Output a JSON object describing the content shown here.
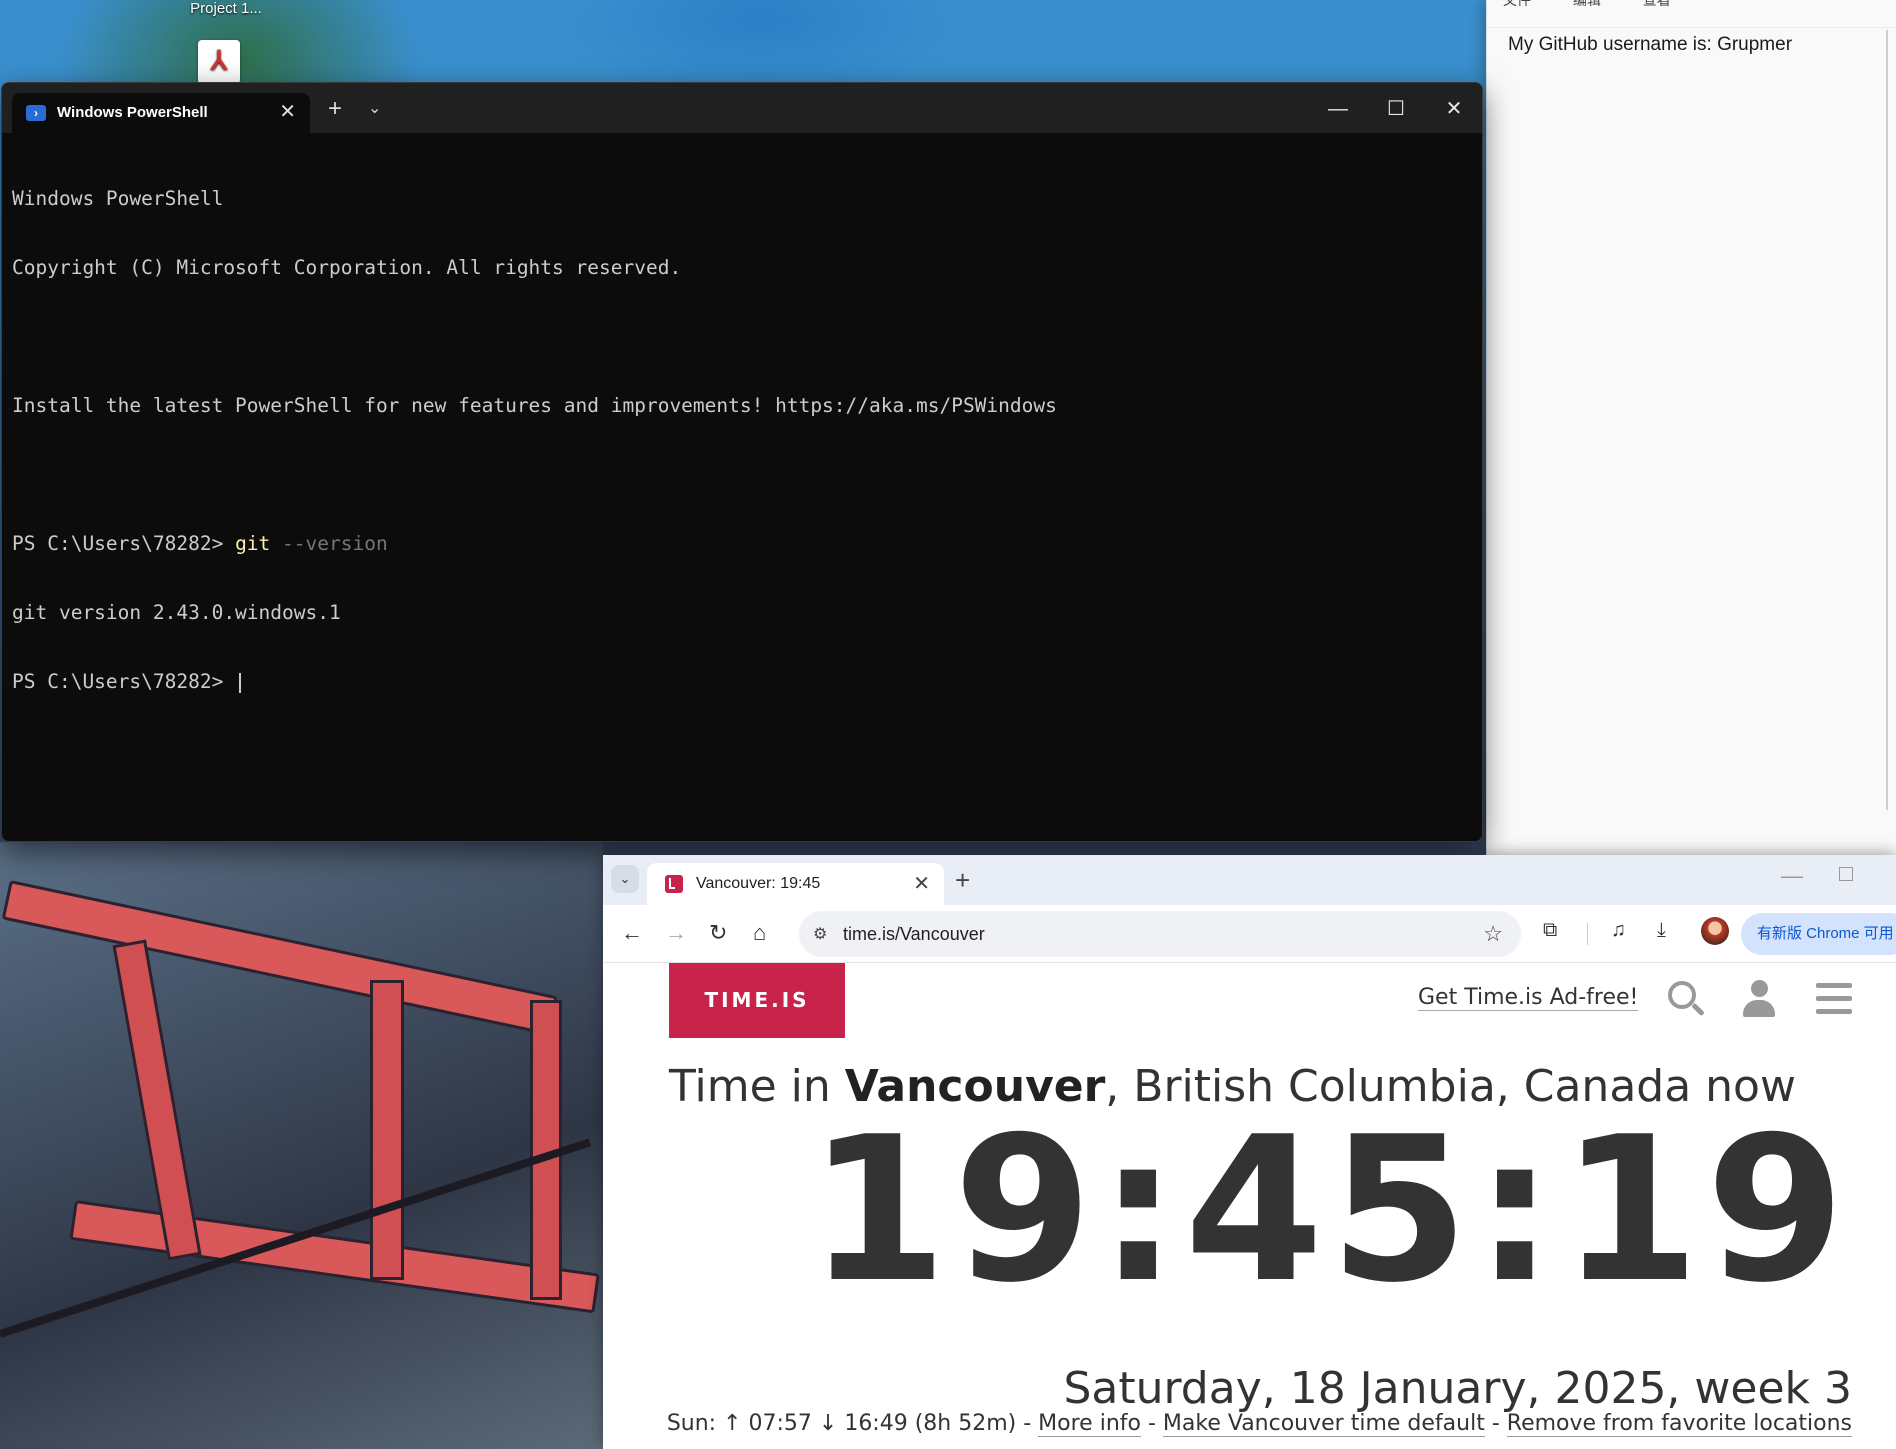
{
  "desktop": {
    "icon_label": "Project 1..."
  },
  "notepad": {
    "menu": [
      "文件",
      "编辑",
      "查看"
    ],
    "content": "My GitHub username is: Grupmer"
  },
  "terminal": {
    "tab_title": "Windows PowerShell",
    "lines": {
      "l1": "Windows PowerShell",
      "l2": "Copyright (C) Microsoft Corporation. All rights reserved.",
      "l3": "Install the latest PowerShell for new features and improvements! https://aka.ms/PSWindows",
      "prompt1": "PS C:\\Users\\78282> ",
      "cmd": "git",
      "cmd_arg": " --version",
      "output": "git version 2.43.0.windows.1",
      "prompt2": "PS C:\\Users\\78282> "
    }
  },
  "chrome": {
    "tab_title": "Vancouver: 19:45",
    "url": "time.is/Vancouver",
    "update_label": "有新版 Chrome 可用"
  },
  "page": {
    "logo": "TIME.IS",
    "adfree": "Get Time.is Ad-free!",
    "headline_pre": "Time in ",
    "headline_city": "Vancouver",
    "headline_post": ", British Columbia, Canada now",
    "clock": "19:45:19",
    "date": "Saturday, 18 January, 2025, week 3",
    "sun_prefix": "Sun: ↑ 07:57 ↓ 16:49 (8h 52m) - ",
    "more_info": "More info",
    "sep1": " - ",
    "make_default": "Make Vancouver time default",
    "sep2": " - ",
    "remove_fav": "Remove from favorite locations"
  }
}
